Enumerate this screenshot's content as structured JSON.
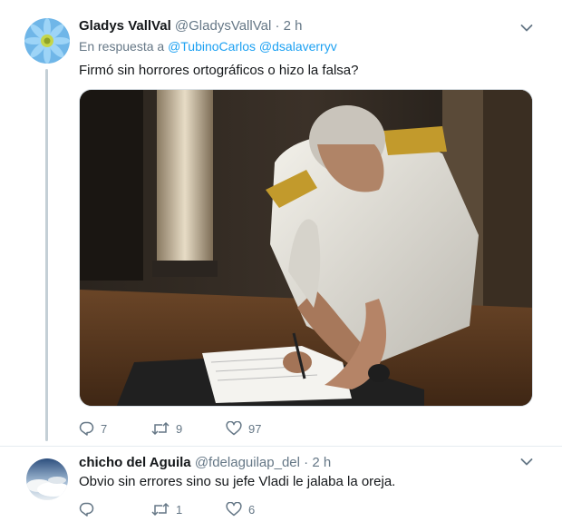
{
  "tweets": [
    {
      "display_name": "Gladys VallVal",
      "handle": "@GladysVallVal",
      "separator": "·",
      "time": "2 h",
      "reply_prefix": "En respuesta a",
      "reply_mentions": [
        "@TubinoCarlos",
        "@dsalaverryv"
      ],
      "text": "Firmó sin horrores ortográficos o hizo la falsa?",
      "replies": "7",
      "retweets": "9",
      "likes": "97",
      "media": "video frame of a man in a white naval uniform signing a document"
    },
    {
      "display_name": "chicho del Aguila",
      "handle": "@fdelaguilap_del",
      "separator": "·",
      "time": "2 h",
      "text": "Obvio sin errores sino su jefe Vladi le jalaba la oreja.",
      "replies": "",
      "retweets": "1",
      "likes": "6"
    }
  ],
  "icons": {
    "reply": "reply-icon",
    "retweet": "retweet-icon",
    "like": "heart-icon",
    "more": "chevron-down-icon"
  },
  "colors": {
    "link": "#1da1f2",
    "muted": "#657786",
    "text": "#14171a",
    "thread_line": "#c4cfd6"
  }
}
